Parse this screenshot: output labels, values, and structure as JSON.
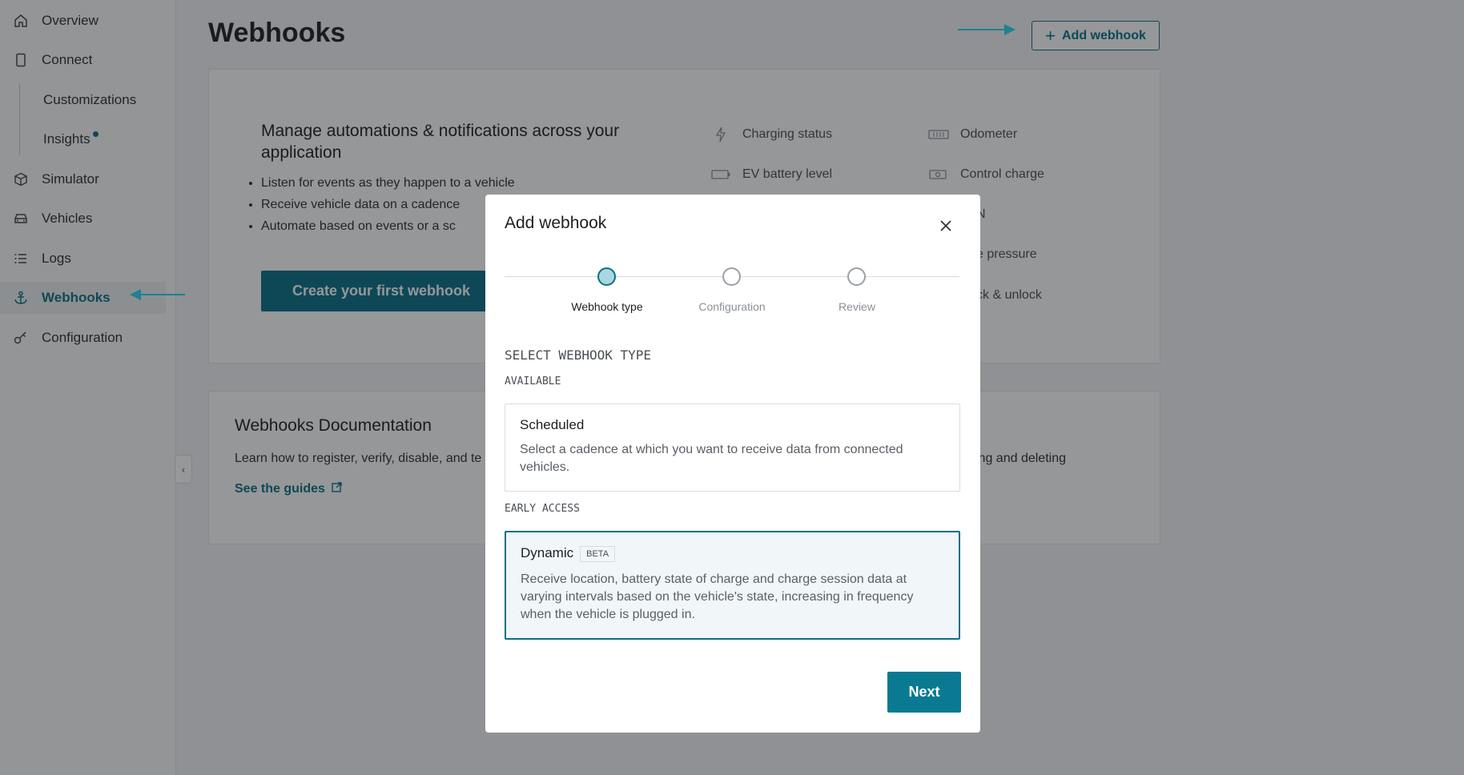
{
  "sidebar": {
    "items": [
      {
        "label": "Overview",
        "icon": "home-icon"
      },
      {
        "label": "Connect",
        "icon": "phone-icon"
      },
      {
        "label": "Simulator",
        "icon": "cube-icon"
      },
      {
        "label": "Vehicles",
        "icon": "car-icon"
      },
      {
        "label": "Logs",
        "icon": "list-icon"
      },
      {
        "label": "Webhooks",
        "icon": "anchor-icon",
        "active": true
      },
      {
        "label": "Configuration",
        "icon": "key-icon"
      }
    ],
    "sub_items": [
      {
        "label": "Customizations"
      },
      {
        "label": "Insights",
        "has_dot": true
      }
    ]
  },
  "page": {
    "title": "Webhooks",
    "add_button_label": "Add webhook"
  },
  "intro_card": {
    "heading": "Manage automations & notifications across your application",
    "bullets": [
      "Listen for events as they happen to a vehicle",
      "Receive vehicle data on a cadence",
      "Automate based on events or a sc"
    ],
    "cta_label": "Create your first webhook",
    "features": [
      {
        "label": "Charging status",
        "icon": "lightning-icon"
      },
      {
        "label": "EV battery level",
        "icon": "battery-icon"
      },
      {
        "label": "Odometer",
        "icon": "odometer-icon"
      },
      {
        "label": "Control charge",
        "icon": "charge-control-icon"
      },
      {
        "label": "N"
      },
      {
        "label": "e pressure"
      },
      {
        "label": "ck & unlock"
      }
    ]
  },
  "docs_card": {
    "heading": "Webhooks Documentation",
    "text_left": "Learn how to register, verify, disable, and te",
    "text_right": "ing and deleting",
    "link_label": "See the guides"
  },
  "modal": {
    "title": "Add webhook",
    "steps": [
      {
        "label": "Webhook type",
        "active": true
      },
      {
        "label": "Configuration",
        "active": false
      },
      {
        "label": "Review",
        "active": false
      }
    ],
    "section_title": "SELECT WEBHOOK TYPE",
    "available_label": "AVAILABLE",
    "early_access_label": "EARLY ACCESS",
    "options": [
      {
        "title": "Scheduled",
        "description": "Select a cadence at which you want to receive data from connected vehicles.",
        "selected": false
      },
      {
        "title": "Dynamic",
        "badge": "BETA",
        "description": "Receive location, battery state of charge and charge session data at varying intervals based on the vehicle's state, increasing in frequency when the vehicle is plugged in.",
        "selected": true
      }
    ],
    "next_label": "Next"
  },
  "colors": {
    "accent": "#0a6f86",
    "annotation_arrow": "#27d9ee"
  }
}
